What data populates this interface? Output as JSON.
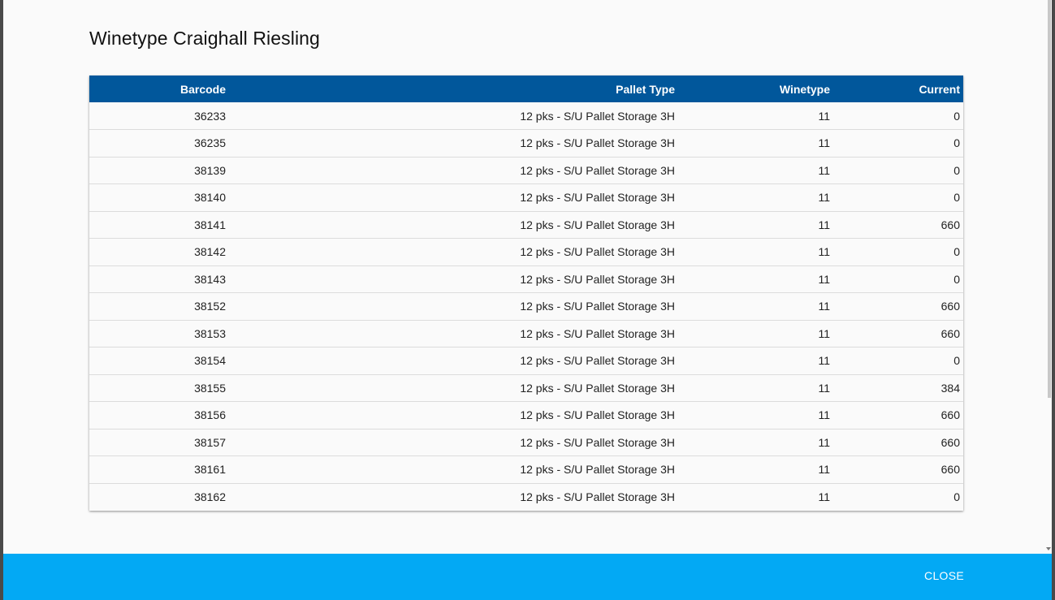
{
  "dialog": {
    "title": "Winetype Craighall Riesling",
    "close_label": "CLOSE"
  },
  "colors": {
    "header_bg": "#01579b",
    "footer_bg": "#03a9f4"
  },
  "table": {
    "columns": [
      "Barcode",
      "Pallet Type",
      "Winetype",
      "Current"
    ],
    "rows": [
      [
        "36233",
        "12 pks - S/U Pallet Storage 3H",
        "11",
        "0"
      ],
      [
        "36235",
        "12 pks - S/U Pallet Storage 3H",
        "11",
        "0"
      ],
      [
        "38139",
        "12 pks - S/U Pallet Storage 3H",
        "11",
        "0"
      ],
      [
        "38140",
        "12 pks - S/U Pallet Storage 3H",
        "11",
        "0"
      ],
      [
        "38141",
        "12 pks - S/U Pallet Storage 3H",
        "11",
        "660"
      ],
      [
        "38142",
        "12 pks - S/U Pallet Storage 3H",
        "11",
        "0"
      ],
      [
        "38143",
        "12 pks - S/U Pallet Storage 3H",
        "11",
        "0"
      ],
      [
        "38152",
        "12 pks - S/U Pallet Storage 3H",
        "11",
        "660"
      ],
      [
        "38153",
        "12 pks - S/U Pallet Storage 3H",
        "11",
        "660"
      ],
      [
        "38154",
        "12 pks - S/U Pallet Storage 3H",
        "11",
        "0"
      ],
      [
        "38155",
        "12 pks - S/U Pallet Storage 3H",
        "11",
        "384"
      ],
      [
        "38156",
        "12 pks - S/U Pallet Storage 3H",
        "11",
        "660"
      ],
      [
        "38157",
        "12 pks - S/U Pallet Storage 3H",
        "11",
        "660"
      ],
      [
        "38161",
        "12 pks - S/U Pallet Storage 3H",
        "11",
        "660"
      ],
      [
        "38162",
        "12 pks - S/U Pallet Storage 3H",
        "11",
        "0"
      ]
    ]
  }
}
